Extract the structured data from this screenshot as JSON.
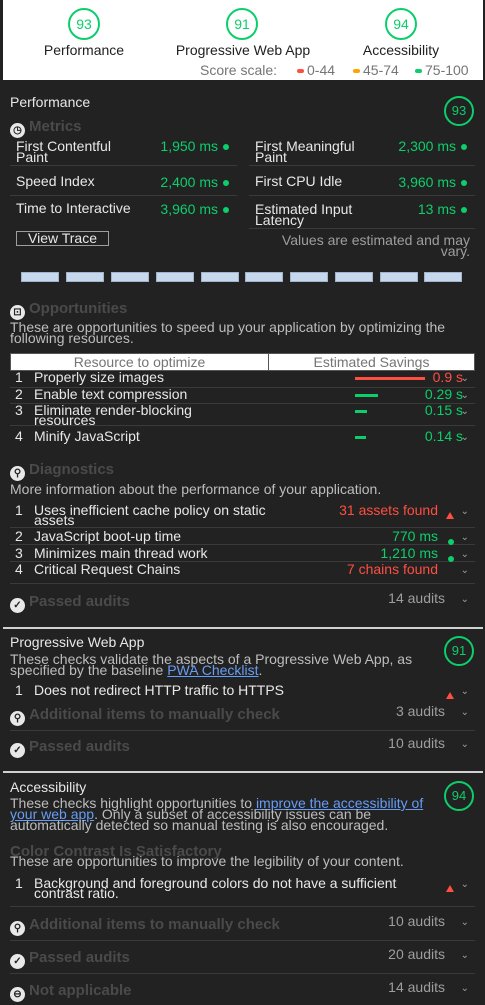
{
  "header": {
    "gauges": [
      {
        "score": "93",
        "label": "Performance"
      },
      {
        "score": "91",
        "label": "Progressive Web App"
      },
      {
        "score": "94",
        "label": "Accessibility"
      }
    ],
    "scale_label": "Score scale:",
    "scale_ranges": [
      "0-44",
      "45-74",
      "75-100"
    ],
    "colors": {
      "pass": "#0cce6b",
      "average": "#ffa400",
      "fail": "#ff4e42"
    }
  },
  "performance": {
    "title": "Performance",
    "score": "93",
    "metrics_heading": "Metrics",
    "metrics": [
      {
        "name": "First Contentful Paint",
        "value": "1,950 ms"
      },
      {
        "name": "First Meaningful Paint",
        "value": "2,300 ms"
      },
      {
        "name": "Speed Index",
        "value": "2,400 ms"
      },
      {
        "name": "First CPU Idle",
        "value": "3,960 ms"
      },
      {
        "name": "Time to Interactive",
        "value": "3,960 ms"
      },
      {
        "name": "Estimated Input Latency",
        "value": "13 ms"
      }
    ],
    "view_trace": "View Trace",
    "estimated_note": "Values are estimated and may vary.",
    "opportunities_heading": "Opportunities",
    "opportunities_desc": "These are opportunities to speed up your application by optimizing the following resources.",
    "col_resource": "Resource to optimize",
    "col_savings": "Estimated Savings",
    "opportunities": [
      {
        "index": "1",
        "title": "Properly size images",
        "savings": "0.9 s",
        "fraction": 0.9
      },
      {
        "index": "2",
        "title": "Enable text compression",
        "savings": "0.29 s",
        "fraction": 0.29
      },
      {
        "index": "3",
        "title": "Eliminate render-blocking resources",
        "savings": "0.15 s",
        "fraction": 0.15
      },
      {
        "index": "4",
        "title": "Minify JavaScript",
        "savings": "0.14 s",
        "fraction": 0.14
      }
    ],
    "diagnostics_heading": "Diagnostics",
    "diagnostics_desc": "More information about the performance of your application.",
    "diagnostics": [
      {
        "index": "1",
        "title": "Uses inefficient cache policy on static assets",
        "value": "31 assets found"
      },
      {
        "index": "2",
        "title": "JavaScript boot-up time",
        "value": "770 ms"
      },
      {
        "index": "3",
        "title": "Minimizes main thread work",
        "value": "1,210 ms"
      },
      {
        "index": "4",
        "title": "Critical Request Chains",
        "value": "7 chains found"
      }
    ],
    "passed_label": "Passed audits",
    "passed_count": "14 audits"
  },
  "pwa": {
    "title": "Progressive Web App",
    "score": "91",
    "desc_pre": "These checks validate the aspects of a Progressive Web App, as specified by the baseline ",
    "desc_link": "PWA Checklist",
    "desc_post": ".",
    "audits": [
      {
        "index": "1",
        "title": "Does not redirect HTTP traffic to HTTPS"
      }
    ],
    "manual_label": "Additional items to manually check",
    "manual_count": "3 audits",
    "passed_label": "Passed audits",
    "passed_count": "10 audits"
  },
  "accessibility": {
    "title": "Accessibility",
    "score": "94",
    "desc_pre": "These checks highlight opportunities to ",
    "desc_link": "improve the accessibility of your web app",
    "desc_post": ". Only a subset of accessibility issues can be automatically detected so manual testing is also encouraged.",
    "group_heading": "Color Contrast Is Satisfactory",
    "group_desc": "These are opportunities to improve the legibility of your content.",
    "audits": [
      {
        "index": "1",
        "title": "Background and foreground colors do not have a sufficient contrast ratio."
      }
    ],
    "manual_label": "Additional items to manually check",
    "manual_count": "10 audits",
    "passed_label": "Passed audits",
    "passed_count": "20 audits",
    "na_label": "Not applicable",
    "na_count": "14 audits"
  }
}
